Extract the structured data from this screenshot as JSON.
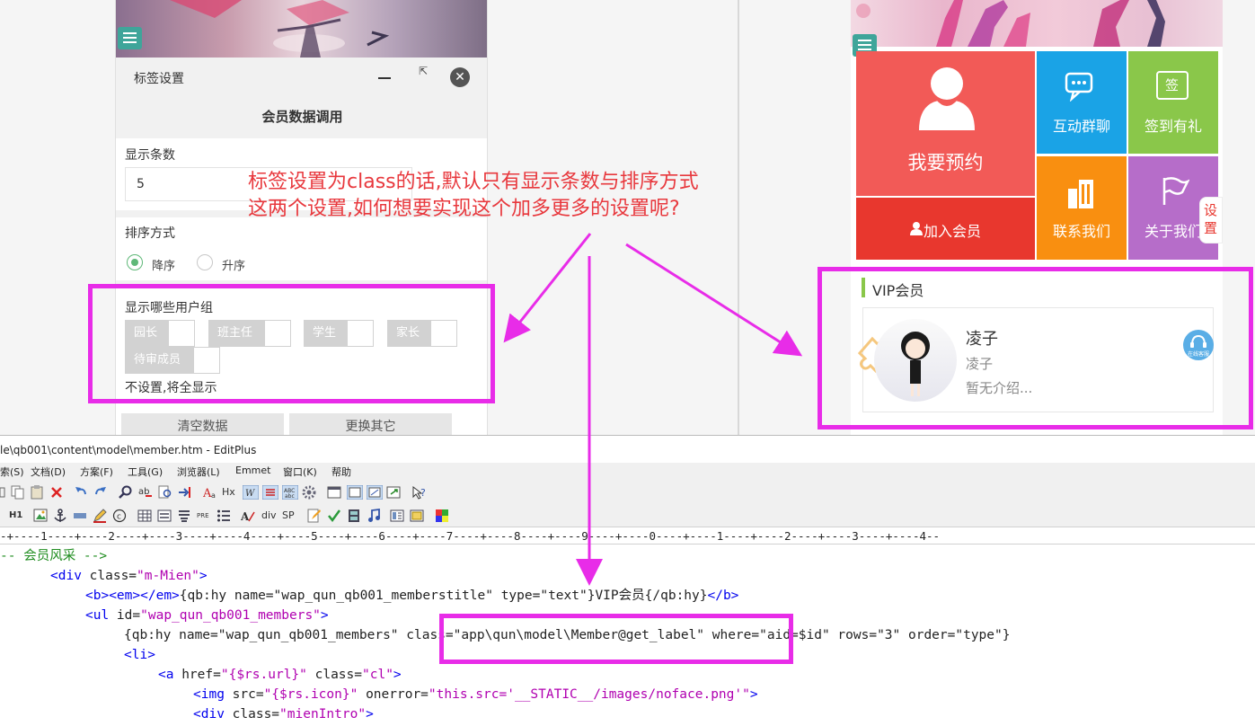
{
  "left_panel": {
    "title": "标签设置",
    "maximize_glyph": "⇱",
    "close_glyph": "✕",
    "section_title": "会员数据调用",
    "count_label": "显示条数",
    "count_value": "5",
    "sort_label": "排序方式",
    "sort_options": [
      "降序",
      "升序"
    ],
    "sort_selected": "降序",
    "groups_label": "显示哪些用户组",
    "groups": [
      "园长",
      "班主任",
      "学生",
      "家长",
      "待审成员"
    ],
    "groups_hint": "不设置,将全显示",
    "buttons": [
      "清空数据",
      "更换其它"
    ]
  },
  "annotation": {
    "line1": "标签设置为class的话,默认只有显示条数与排序方式",
    "line2": "这两个设置,如何想要实现这个加多更多的设置呢?",
    "color": "#e8383d",
    "highlight_color": "#e82ce8"
  },
  "right_panel": {
    "tiles": {
      "booking": "我要预约",
      "join": "加入会员",
      "chat": "互动群聊",
      "signin": "签到有礼",
      "contact": "联系我们",
      "about": "关于我们",
      "signin_icon_char": "签"
    },
    "settings_tab": "设置",
    "vip_title": "VIP会员",
    "member": {
      "name": "凌子",
      "subname": "凌子",
      "intro": "暂无介绍...",
      "online_badge": "在线客服"
    },
    "colors": {
      "booking": "#f25a57",
      "join": "#e8372e",
      "chat": "#1aa3e6",
      "signin": "#8ac74a",
      "contact": "#f98f10",
      "about": "#b66dc9"
    }
  },
  "editor": {
    "title": "le\\qb001\\content\\model\\member.htm - EditPlus",
    "menu": [
      "索(S)",
      "文档(D)",
      "方案(F)",
      "工具(G)",
      "浏览器(L)",
      "Emmet",
      "窗口(K)",
      "帮助"
    ],
    "ruler": "-+----1----+----2----+----3----+----4----+----5----+----6----+----7----+----8----+----9----+----0----+----1----+----2----+----3----+----4--",
    "toolbar_text": {
      "hx": "Hx",
      "h1": "H1",
      "pre": "PRE",
      "div": "div",
      "sp": "SP"
    },
    "code": {
      "l1": "-- 会员风采 -->",
      "l2a": "<div ",
      "l2b": "class=",
      "l2c": "\"m-Mien\"",
      "l2d": ">",
      "l3a": "<b>",
      "l3b": "<em>",
      "l3c": "</em>",
      "l3d": "{qb:hy name=\"wap_qun_qb001_memberstitle\" type=\"text\"}VIP会员{/qb:hy}",
      "l3e": "</b>",
      "l4a": "<ul ",
      "l4b": "id=",
      "l4c": "\"wap_qun_qb001_members\"",
      "l4d": ">",
      "l5a": "{qb:hy name=\"wap_qun_qb001_members\" ",
      "l5b": "class=\"app\\qun\\model\\Member@get_label\"",
      "l5c": " where=\"aid=$id\" rows=\"3\" order=\"type\"}",
      "l6": "<li>",
      "l7a": "<a ",
      "l7b": "href=",
      "l7c": "\"{$rs.url}\"",
      "l7d": " class=",
      "l7e": "\"cl\"",
      "l7f": ">",
      "l8a": "<img ",
      "l8b": "src=",
      "l8c": "\"{$rs.icon}\"",
      "l8d": " onerror=",
      "l8e": "\"this.src='__STATIC__/images/noface.png'\"",
      "l8f": ">",
      "l9a": "<div ",
      "l9b": "class=",
      "l9c": "\"mienIntro\"",
      "l9d": ">"
    }
  }
}
